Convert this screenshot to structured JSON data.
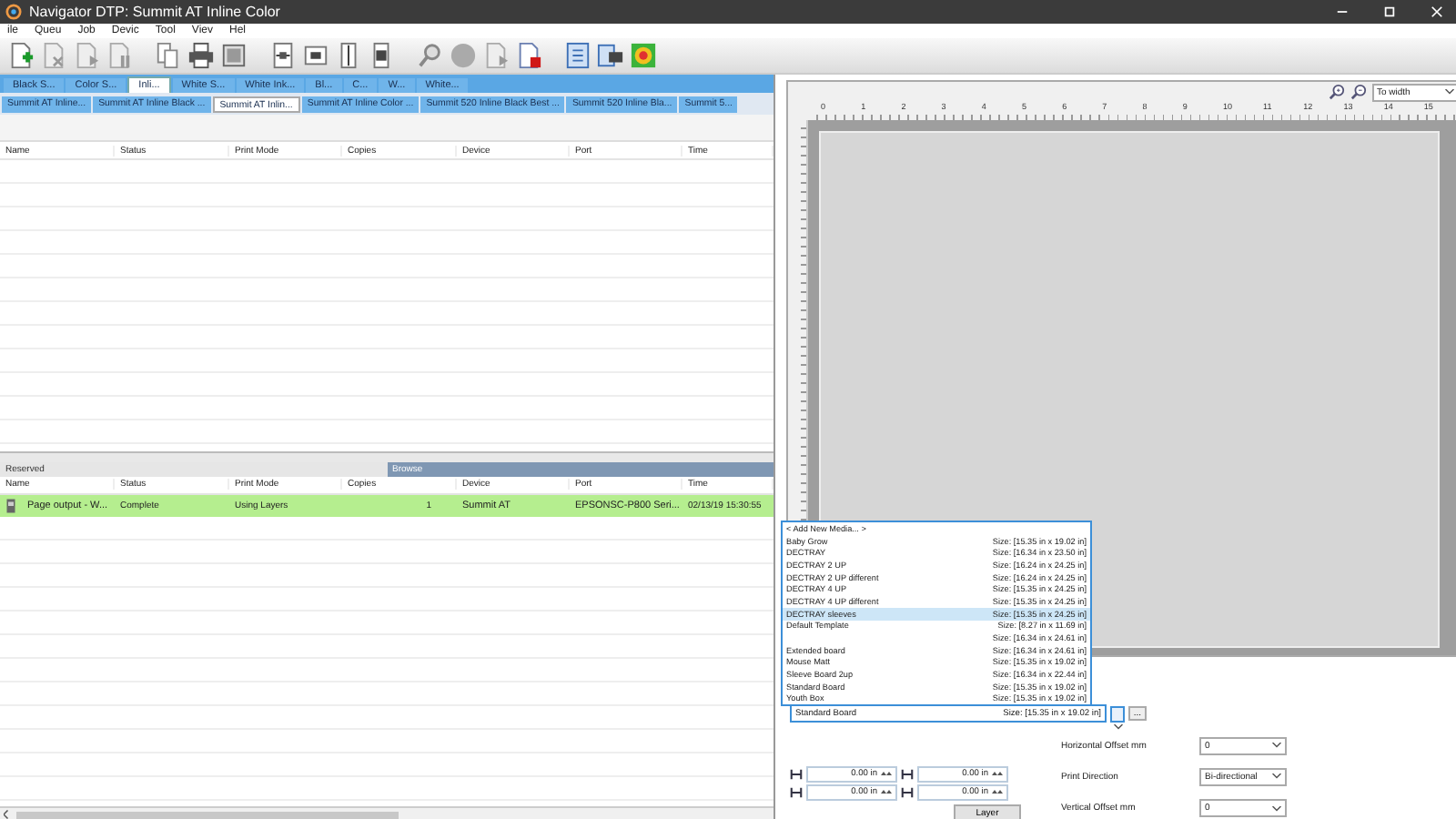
{
  "window": {
    "title": "Navigator DTP: Summit AT Inline Color"
  },
  "menu": [
    "ile",
    "Queu",
    "Job",
    "Devic",
    "Tool",
    "Viev",
    "Hel"
  ],
  "queue_tabs": [
    {
      "label": "Black S...",
      "selected": false
    },
    {
      "label": "Color S...",
      "selected": false
    },
    {
      "label": "Inli...",
      "selected": true
    },
    {
      "label": "White S...",
      "selected": false
    },
    {
      "label": "White Ink...",
      "selected": false
    },
    {
      "label": "Bl...",
      "selected": false
    },
    {
      "label": "C...",
      "selected": false
    },
    {
      "label": "W...",
      "selected": false
    },
    {
      "label": "White...",
      "selected": false
    }
  ],
  "printer_tabs": [
    {
      "label": "Summit AT Inline...",
      "selected": false
    },
    {
      "label": "Summit AT Inline Black ...",
      "selected": false
    },
    {
      "label": "Summit AT Inlin...",
      "selected": true
    },
    {
      "label": "Summit AT Inline Color ...",
      "selected": false
    },
    {
      "label": "Summit 520 Inline Black Best ...",
      "selected": false
    },
    {
      "label": "Summit 520 Inline Bla...",
      "selected": false
    },
    {
      "label": "Summit 5...",
      "selected": false
    }
  ],
  "jobs_table": {
    "columns": [
      "Name",
      "Status",
      "Print Mode",
      "Copies",
      "Device",
      "Port",
      "Time"
    ]
  },
  "history_tabs": [
    {
      "label": "Reserved",
      "selected": false
    },
    {
      "label": "Browse",
      "selected": true
    }
  ],
  "history_table": {
    "columns": [
      "Name",
      "Status",
      "Print Mode",
      "Copies",
      "Device",
      "Port",
      "Time"
    ],
    "rows": [
      {
        "selected": true,
        "cells": [
          "Page output - W...",
          "Complete",
          "Using Layers",
          "1",
          "Summit AT",
          "EPSONSC-P800 Seri...",
          "02/13/19 15:30:55"
        ]
      }
    ]
  },
  "preview": {
    "zoom": "To width",
    "ruler": [
      "0",
      "1",
      "2",
      "3",
      "4",
      "5",
      "6",
      "7",
      "8",
      "9",
      "10",
      "11",
      "12",
      "13",
      "14",
      "15"
    ]
  },
  "media_dropdown": {
    "items": [
      {
        "kind": "action",
        "name": "< Add New Media... >",
        "selected": false
      },
      {
        "kind": "media",
        "name": "Baby Grow",
        "size": "Size: [15.35 in x 19.02 in]",
        "selected": false
      },
      {
        "kind": "media",
        "name": "DECTRAY",
        "size": "Size: [16.34 in x 23.50 in]",
        "selected": false
      },
      {
        "kind": "media",
        "name": "DECTRAY 2 UP",
        "size": "Size: [16.24 in x 24.25 in]",
        "selected": false
      },
      {
        "kind": "media",
        "name": "DECTRAY 2 UP different",
        "size": "Size: [16.24 in x 24.25 in]",
        "selected": false
      },
      {
        "kind": "media",
        "name": "DECTRAY 4 UP",
        "size": "Size: [15.35 in x 24.25 in]",
        "selected": false
      },
      {
        "kind": "media",
        "name": "DECTRAY 4 UP different",
        "size": "Size: [15.35 in x 24.25 in]",
        "selected": false
      },
      {
        "kind": "media",
        "name": "DECTRAY sleeves",
        "size": "Size: [15.35 in x 24.25 in]",
        "selected": true
      },
      {
        "kind": "media",
        "name": "Default Template",
        "size": "Size: [8.27 in x 11.69 in]",
        "selected": false
      },
      {
        "kind": "media",
        "size": "Size: [16.34 in x 24.61 in]",
        "selected": false
      },
      {
        "kind": "media",
        "name": "Extended board",
        "size": "Size: [16.34 in x 24.61 in]",
        "selected": false
      },
      {
        "kind": "media",
        "name": "Mouse Matt",
        "size": "Size: [15.35 in x 19.02 in]",
        "selected": false
      },
      {
        "kind": "media",
        "name": "Sleeve Board 2up",
        "size": "Size: [16.34 in x 22.44 in]",
        "selected": false
      },
      {
        "kind": "media",
        "name": "Standard Board",
        "size": "Size: [15.35 in x 19.02 in]",
        "selected": false
      },
      {
        "kind": "media",
        "name": "Youth Box",
        "size": "Size: [15.35 in x 19.02 in]",
        "selected": false
      }
    ]
  },
  "media_select": {
    "name": "Standard Board",
    "size": "Size: [15.35 in x 19.02 in]",
    "more": "..."
  },
  "margins": [
    "0.00 in",
    "0.00 in",
    "0.00 in",
    "0.00 in"
  ],
  "settings": [
    {
      "label": "Horizontal Offset mm",
      "value": "0"
    },
    {
      "label": "Print Direction",
      "value": "Bi-directional"
    },
    {
      "label": "Vertical Offset mm",
      "value": "0"
    }
  ],
  "layer_button": "Layer"
}
